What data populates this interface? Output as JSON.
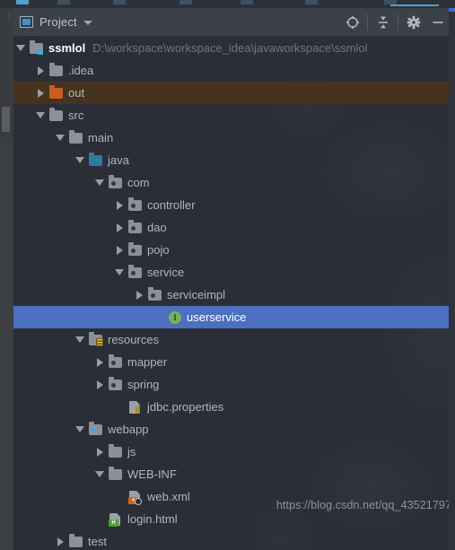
{
  "window": {
    "panel_title": "Project",
    "panel_icon": "project-icon",
    "watermark": "https://blog.csdn.net/qq_43521797"
  },
  "toolbar": {
    "buttons": [
      {
        "name": "select-opened-file-icon",
        "label": "Select Opened File"
      },
      {
        "name": "collapse-all-icon",
        "label": "Collapse All"
      },
      {
        "name": "gear-icon",
        "label": "Settings"
      },
      {
        "name": "minimize-icon",
        "label": "Hide"
      }
    ]
  },
  "colors": {
    "selection": "#4b70bf",
    "excluded_row": "#46331f",
    "panel_bg": "#2b2e36",
    "header_bg": "#3c4049",
    "text": "#a9b7c6",
    "muted_text": "#6f7780",
    "folder": "#8a9199",
    "folder_excluded": "#cc5c21",
    "source_root": "#2c7ba0",
    "interface_icon": "#77b259"
  },
  "tree": {
    "rows": [
      {
        "label": "ssmlol",
        "sublabel": "D:\\workspace\\workspace_idea\\javaworkspace\\ssmlol",
        "depth": 0,
        "twisty": "expanded",
        "icon": "module-folder-icon",
        "bold": true,
        "state": "normal",
        "name": "tree-node-ssmlol"
      },
      {
        "label": ".idea",
        "sublabel": "",
        "depth": 1,
        "twisty": "collapsed",
        "icon": "folder-icon",
        "bold": false,
        "state": "normal",
        "name": "tree-node-idea"
      },
      {
        "label": "out",
        "sublabel": "",
        "depth": 1,
        "twisty": "collapsed",
        "icon": "folder-excluded-icon",
        "bold": false,
        "state": "excluded",
        "name": "tree-node-out"
      },
      {
        "label": "src",
        "sublabel": "",
        "depth": 1,
        "twisty": "expanded",
        "icon": "folder-icon",
        "bold": false,
        "state": "normal",
        "name": "tree-node-src"
      },
      {
        "label": "main",
        "sublabel": "",
        "depth": 2,
        "twisty": "expanded",
        "icon": "folder-icon",
        "bold": false,
        "state": "normal",
        "name": "tree-node-main"
      },
      {
        "label": "java",
        "sublabel": "",
        "depth": 3,
        "twisty": "expanded",
        "icon": "source-root-folder-icon",
        "bold": false,
        "state": "normal",
        "name": "tree-node-java"
      },
      {
        "label": "com",
        "sublabel": "",
        "depth": 4,
        "twisty": "expanded",
        "icon": "package-icon",
        "bold": false,
        "state": "normal",
        "name": "tree-node-com"
      },
      {
        "label": "controller",
        "sublabel": "",
        "depth": 5,
        "twisty": "collapsed",
        "icon": "package-icon",
        "bold": false,
        "state": "normal",
        "name": "tree-node-controller"
      },
      {
        "label": "dao",
        "sublabel": "",
        "depth": 5,
        "twisty": "collapsed",
        "icon": "package-icon",
        "bold": false,
        "state": "normal",
        "name": "tree-node-dao"
      },
      {
        "label": "pojo",
        "sublabel": "",
        "depth": 5,
        "twisty": "collapsed",
        "icon": "package-icon",
        "bold": false,
        "state": "normal",
        "name": "tree-node-pojo"
      },
      {
        "label": "service",
        "sublabel": "",
        "depth": 5,
        "twisty": "expanded",
        "icon": "package-icon",
        "bold": false,
        "state": "normal",
        "name": "tree-node-service"
      },
      {
        "label": "serviceimpl",
        "sublabel": "",
        "depth": 6,
        "twisty": "collapsed",
        "icon": "package-icon",
        "bold": false,
        "state": "normal",
        "name": "tree-node-serviceimpl"
      },
      {
        "label": "userservice",
        "sublabel": "",
        "depth": 7,
        "twisty": "none",
        "icon": "interface-icon",
        "bold": false,
        "state": "selected",
        "name": "tree-node-userservice"
      },
      {
        "label": "resources",
        "sublabel": "",
        "depth": 3,
        "twisty": "expanded",
        "icon": "resource-root-folder-icon",
        "bold": false,
        "state": "normal",
        "name": "tree-node-resources"
      },
      {
        "label": "mapper",
        "sublabel": "",
        "depth": 4,
        "twisty": "collapsed",
        "icon": "package-icon",
        "bold": false,
        "state": "normal",
        "name": "tree-node-mapper"
      },
      {
        "label": "spring",
        "sublabel": "",
        "depth": 4,
        "twisty": "collapsed",
        "icon": "package-icon",
        "bold": false,
        "state": "normal",
        "name": "tree-node-spring"
      },
      {
        "label": "jdbc.properties",
        "sublabel": "",
        "depth": 5,
        "twisty": "none",
        "icon": "properties-file-icon",
        "bold": false,
        "state": "normal",
        "name": "tree-node-jdbc-properties"
      },
      {
        "label": "webapp",
        "sublabel": "",
        "depth": 3,
        "twisty": "expanded",
        "icon": "web-root-folder-icon",
        "bold": false,
        "state": "normal",
        "name": "tree-node-webapp"
      },
      {
        "label": "js",
        "sublabel": "",
        "depth": 4,
        "twisty": "collapsed",
        "icon": "folder-icon",
        "bold": false,
        "state": "normal",
        "name": "tree-node-js"
      },
      {
        "label": "WEB-INF",
        "sublabel": "",
        "depth": 4,
        "twisty": "expanded",
        "icon": "folder-icon",
        "bold": false,
        "state": "normal",
        "name": "tree-node-web-inf"
      },
      {
        "label": "web.xml",
        "sublabel": "",
        "depth": 5,
        "twisty": "none",
        "icon": "xml-file-icon",
        "bold": false,
        "state": "normal",
        "name": "tree-node-web-xml"
      },
      {
        "label": "login.html",
        "sublabel": "",
        "depth": 4,
        "twisty": "none",
        "icon": "html-file-icon",
        "bold": false,
        "state": "normal",
        "name": "tree-node-login-html"
      },
      {
        "label": "test",
        "sublabel": "",
        "depth": 2,
        "twisty": "collapsed",
        "icon": "folder-icon",
        "bold": false,
        "state": "normal",
        "name": "tree-node-test"
      }
    ]
  }
}
